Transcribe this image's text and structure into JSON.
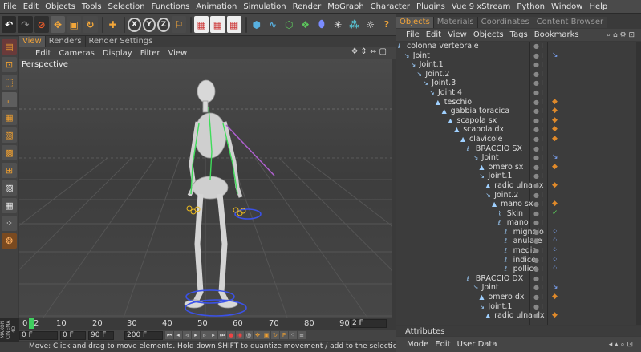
{
  "menu": [
    "File",
    "Edit",
    "Objects",
    "Tools",
    "Selection",
    "Functions",
    "Animation",
    "Simulation",
    "Render",
    "MoGraph",
    "Character",
    "Plugins",
    "Vue 9 xStream",
    "Python",
    "Window",
    "Help"
  ],
  "toolbar": {
    "undo_icon": "undo-icon",
    "axis_x": "X",
    "axis_y": "Y",
    "axis_z": "Z"
  },
  "viewport": {
    "tabs": [
      "View",
      "Renders",
      "Render Settings"
    ],
    "menu": [
      "Edit",
      "Cameras",
      "Display",
      "Filter",
      "View"
    ],
    "label": "Perspective",
    "controls": "✥ ⇕ ⇔ ▢"
  },
  "timeline": {
    "ticks": [
      "0",
      "2",
      "10",
      "20",
      "30",
      "40",
      "50",
      "60",
      "70",
      "80",
      "90"
    ],
    "frame_field": "2 F",
    "start": "0 F",
    "mid_left": "0 F",
    "mid_right": "90 F",
    "end": "200 F"
  },
  "status": "Move: Click and drag to move elements. Hold down SHIFT to quantize movement / add to the selection in p",
  "brand": "MAXON CINEMA 4D",
  "right_panel": {
    "tabs": [
      "Objects",
      "Materials",
      "Coordinates",
      "Content Browser"
    ],
    "menu": [
      "File",
      "Edit",
      "View",
      "Objects",
      "Tags",
      "Bookmarks"
    ],
    "header_icons": "⌕ ⌂ ⚙ ⊡"
  },
  "objects": [
    {
      "name": "colonna vertebrale",
      "indent": 0,
      "icon": "null",
      "tags": ""
    },
    {
      "name": "Joint",
      "indent": 1,
      "icon": "joint",
      "tags": "blue"
    },
    {
      "name": "Joint.1",
      "indent": 2,
      "icon": "joint",
      "tags": ""
    },
    {
      "name": "Joint.2",
      "indent": 3,
      "icon": "joint",
      "tags": ""
    },
    {
      "name": "Joint.3",
      "indent": 4,
      "icon": "joint",
      "tags": ""
    },
    {
      "name": "Joint.4",
      "indent": 5,
      "icon": "joint",
      "tags": ""
    },
    {
      "name": "teschio",
      "indent": 6,
      "icon": "mesh",
      "tags": "orange"
    },
    {
      "name": "gabbia toracica",
      "indent": 7,
      "icon": "mesh",
      "tags": "orange"
    },
    {
      "name": "scapola sx",
      "indent": 8,
      "icon": "mesh",
      "tags": "orange"
    },
    {
      "name": "scapola dx",
      "indent": 9,
      "icon": "mesh",
      "tags": "orange"
    },
    {
      "name": "clavicole",
      "indent": 10,
      "icon": "mesh",
      "tags": "orange"
    },
    {
      "name": "BRACCIO SX",
      "indent": 11,
      "icon": "null",
      "tags": ""
    },
    {
      "name": "Joint",
      "indent": 12,
      "icon": "joint",
      "tags": "blue"
    },
    {
      "name": "omero sx",
      "indent": 13,
      "icon": "mesh",
      "tags": "orange"
    },
    {
      "name": "Joint.1",
      "indent": 13,
      "icon": "joint",
      "tags": ""
    },
    {
      "name": "radio ulna sx",
      "indent": 14,
      "icon": "mesh",
      "tags": "orange"
    },
    {
      "name": "Joint.2",
      "indent": 14,
      "icon": "joint",
      "tags": ""
    },
    {
      "name": "mano sx",
      "indent": 15,
      "icon": "mesh",
      "tags": "orange"
    },
    {
      "name": "Skin",
      "indent": 16,
      "icon": "skin",
      "tags": "check"
    },
    {
      "name": "mano",
      "indent": 16,
      "icon": "null",
      "tags": ""
    },
    {
      "name": "mignolo",
      "indent": 17,
      "icon": "null",
      "tags": "dots"
    },
    {
      "name": "anulare",
      "indent": 17,
      "icon": "null",
      "tags": "dots"
    },
    {
      "name": "medio",
      "indent": 17,
      "icon": "null",
      "tags": "dots"
    },
    {
      "name": "indice",
      "indent": 17,
      "icon": "null",
      "tags": "dots"
    },
    {
      "name": "pollice",
      "indent": 17,
      "icon": "null",
      "tags": "dots"
    },
    {
      "name": "BRACCIO DX",
      "indent": 11,
      "icon": "null",
      "tags": ""
    },
    {
      "name": "Joint",
      "indent": 12,
      "icon": "joint",
      "tags": "blue"
    },
    {
      "name": "omero dx",
      "indent": 13,
      "icon": "mesh",
      "tags": "orange"
    },
    {
      "name": "Joint.1",
      "indent": 13,
      "icon": "joint",
      "tags": ""
    },
    {
      "name": "radio ulna dx",
      "indent": 14,
      "icon": "mesh",
      "tags": "orange"
    }
  ],
  "attributes": {
    "title": "Attributes",
    "menu": [
      "Mode",
      "Edit",
      "User Data"
    ],
    "icons": "◂ ▴ ⌕ ⊡"
  }
}
